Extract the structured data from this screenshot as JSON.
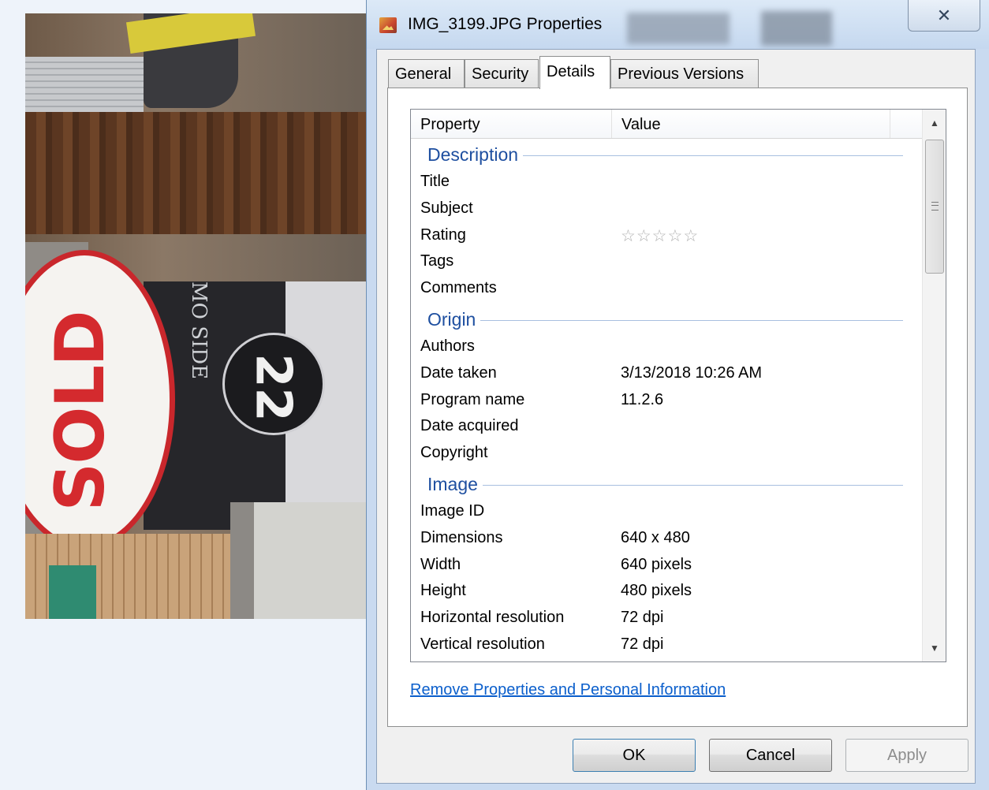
{
  "window": {
    "title": "IMG_3199.JPG Properties",
    "close_glyph": "✕"
  },
  "tabs": [
    {
      "label": "General"
    },
    {
      "label": "Security"
    },
    {
      "label": "Details",
      "active": true
    },
    {
      "label": "Previous Versions"
    }
  ],
  "list": {
    "columns": {
      "property": "Property",
      "value": "Value"
    },
    "groups": [
      {
        "name": "Description",
        "rows": [
          {
            "property": "Title",
            "value": ""
          },
          {
            "property": "Subject",
            "value": ""
          },
          {
            "property": "Rating",
            "value": "",
            "rating_stars": 0,
            "rating_max": 5
          },
          {
            "property": "Tags",
            "value": ""
          },
          {
            "property": "Comments",
            "value": ""
          }
        ]
      },
      {
        "name": "Origin",
        "rows": [
          {
            "property": "Authors",
            "value": ""
          },
          {
            "property": "Date taken",
            "value": "3/13/2018 10:26 AM"
          },
          {
            "property": "Program name",
            "value": "11.2.6"
          },
          {
            "property": "Date acquired",
            "value": ""
          },
          {
            "property": "Copyright",
            "value": ""
          }
        ]
      },
      {
        "name": "Image",
        "rows": [
          {
            "property": "Image ID",
            "value": ""
          },
          {
            "property": "Dimensions",
            "value": "640 x 480"
          },
          {
            "property": "Width",
            "value": "640 pixels"
          },
          {
            "property": "Height",
            "value": "480 pixels"
          },
          {
            "property": "Horizontal resolution",
            "value": "72 dpi"
          },
          {
            "property": "Vertical resolution",
            "value": "72 dpi"
          }
        ]
      }
    ]
  },
  "link": {
    "remove_properties": "Remove Properties and Personal Information"
  },
  "buttons": {
    "ok": "OK",
    "cancel": "Cancel",
    "apply": "Apply"
  },
  "photo": {
    "sign_text": "SOLD",
    "lot_number": "22",
    "sign_side_text": "MO    SIDE"
  },
  "colors": {
    "group_header": "#1e4fa0",
    "link": "#0b5fcc",
    "sold_red": "#d42a2e"
  },
  "icons": {
    "app": "photo-file-icon",
    "close": "close-icon",
    "scroll_up": "arrow-up-icon",
    "scroll_down": "arrow-down-icon",
    "rating": "star-outline-icon"
  }
}
